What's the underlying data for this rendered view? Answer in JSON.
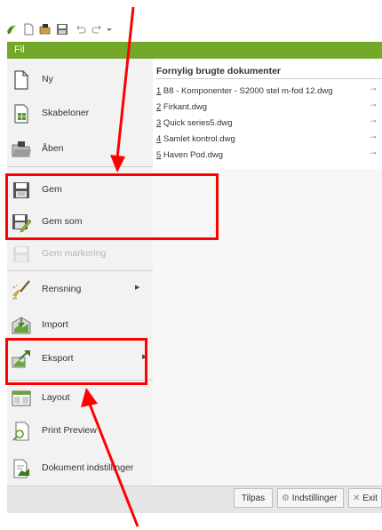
{
  "file_tab": "Fil",
  "quick_access": {
    "icons": [
      "app-logo-icon",
      "new-file-icon",
      "open-folder-icon",
      "save-icon",
      "undo-icon",
      "redo-icon",
      "dropdown-icon"
    ]
  },
  "menu": {
    "items": [
      {
        "label": "Ny",
        "icon": "new-document-icon",
        "enabled": true
      },
      {
        "label": "Skabeloner",
        "icon": "template-icon",
        "enabled": true
      },
      {
        "label": "Åben",
        "icon": "open-folder-icon",
        "enabled": true
      },
      {
        "label": "Gem",
        "icon": "save-icon",
        "enabled": true
      },
      {
        "label": "Gem som",
        "icon": "save-as-icon",
        "enabled": true
      },
      {
        "label": "Gem markering",
        "icon": "save-selection-icon",
        "enabled": false
      },
      {
        "label": "Rensning",
        "icon": "broom-icon",
        "enabled": true,
        "submenu": true
      },
      {
        "label": "Import",
        "icon": "import-icon",
        "enabled": true
      },
      {
        "label": "Eksport",
        "icon": "export-icon",
        "enabled": true,
        "submenu": true
      },
      {
        "label": "Layout",
        "icon": "layout-icon",
        "enabled": true
      },
      {
        "label": "Print Preview",
        "icon": "print-preview-icon",
        "enabled": true
      },
      {
        "label": "Dokument indstillinger",
        "icon": "document-settings-icon",
        "enabled": true
      }
    ]
  },
  "recent": {
    "title": "Fornylig brugte dokumenter",
    "files": [
      {
        "num": "1",
        "name": " B8 - Komponenter - S2000 stel m-fod 12.dwg"
      },
      {
        "num": "2",
        "name": " Firkant.dwg"
      },
      {
        "num": "3",
        "name": " Quick series5.dwg"
      },
      {
        "num": "4",
        "name": " Samlet kontrol.dwg"
      },
      {
        "num": "5",
        "name": " Haven Pod.dwg"
      }
    ]
  },
  "bottom_bar": {
    "tilpas": "Tilpas",
    "indstillinger": "Indstillinger",
    "exit": "Exit"
  },
  "colors": {
    "file_tab_green": "#74a82a",
    "annotation_red": "#ff0000"
  }
}
